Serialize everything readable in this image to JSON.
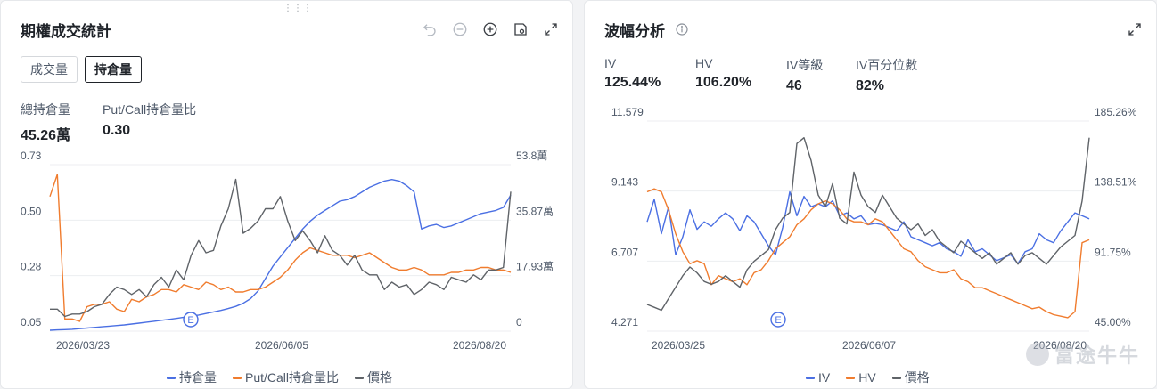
{
  "left": {
    "drag_glyph": "⋮⋮⋮",
    "title": "期權成交統計",
    "toolbar_icons": [
      "undo-icon",
      "zoom-out-icon",
      "zoom-in-icon",
      "settings-icon",
      "expand-icon"
    ],
    "tabs": [
      {
        "label": "成交量",
        "active": false
      },
      {
        "label": "持倉量",
        "active": true
      }
    ],
    "stats": [
      {
        "label": "總持倉量",
        "value": "45.26萬"
      },
      {
        "label": "Put/Call持倉量比",
        "value": "0.30"
      }
    ],
    "legend": [
      "持倉量",
      "Put/Call持倉量比",
      "價格"
    ],
    "colors": {
      "open_interest": "#4a6fe3",
      "ratio": "#f07c2e",
      "price": "#5f6368"
    },
    "earnings_marker": "E"
  },
  "right": {
    "title": "波幅分析",
    "toolbar_icons": [
      "expand-icon"
    ],
    "stats": [
      {
        "label": "IV",
        "value": "125.44%"
      },
      {
        "label": "HV",
        "value": "106.20%"
      },
      {
        "label": "IV等級",
        "value": "46"
      },
      {
        "label": "IV百分位數",
        "value": "82%"
      }
    ],
    "legend": [
      "IV",
      "HV",
      "價格"
    ],
    "colors": {
      "iv": "#4a6fe3",
      "hv": "#f07c2e",
      "price": "#5f6368"
    },
    "earnings_marker": "E",
    "watermark": "富途牛牛"
  },
  "chart_data": [
    {
      "type": "line",
      "x_labels": [
        "2026/03/23",
        "2026/06/05",
        "2026/08/20"
      ],
      "left_axis": {
        "ticks": [
          "0.73",
          "0.50",
          "0.28",
          "0.05"
        ],
        "range": [
          0.05,
          0.73
        ]
      },
      "right_axis": {
        "ticks": [
          "53.8萬",
          "35.87萬",
          "17.93萬",
          "0"
        ],
        "range": [
          0,
          53.8
        ]
      },
      "series": [
        {
          "name": "持倉量",
          "axis": "right",
          "values": [
            0.3,
            0.4,
            0.5,
            0.6,
            0.8,
            1.0,
            1.2,
            1.4,
            1.6,
            1.8,
            2.0,
            2.3,
            2.6,
            2.9,
            3.2,
            3.5,
            3.8,
            4.1,
            4.5,
            4.8,
            5.2,
            5.7,
            6.2,
            6.7,
            7.3,
            8.0,
            9.0,
            10.5,
            13.0,
            17.0,
            21.0,
            24.0,
            27.0,
            30.0,
            33.0,
            35.5,
            37.5,
            39.0,
            40.5,
            42.0,
            42.5,
            43.5,
            45.0,
            46.5,
            47.5,
            48.5,
            49.0,
            48.5,
            47.0,
            45.0,
            33.0,
            34.0,
            34.5,
            33.5,
            34.0,
            35.0,
            36.0,
            37.0,
            38.0,
            38.5,
            39.0,
            40.0,
            44.0
          ]
        },
        {
          "name": "Put/Call持倉量比",
          "axis": "left",
          "values": [
            0.6,
            0.69,
            0.1,
            0.1,
            0.09,
            0.15,
            0.16,
            0.16,
            0.17,
            0.14,
            0.13,
            0.18,
            0.17,
            0.19,
            0.2,
            0.22,
            0.22,
            0.21,
            0.24,
            0.23,
            0.22,
            0.25,
            0.24,
            0.22,
            0.23,
            0.21,
            0.21,
            0.22,
            0.22,
            0.23,
            0.25,
            0.27,
            0.3,
            0.34,
            0.37,
            0.39,
            0.38,
            0.37,
            0.36,
            0.36,
            0.36,
            0.35,
            0.36,
            0.37,
            0.35,
            0.33,
            0.31,
            0.3,
            0.3,
            0.31,
            0.3,
            0.28,
            0.28,
            0.28,
            0.29,
            0.29,
            0.3,
            0.3,
            0.31,
            0.31,
            0.3,
            0.3,
            0.29
          ]
        },
        {
          "name": "價格",
          "axis": "left",
          "values": [
            0.14,
            0.14,
            0.11,
            0.12,
            0.12,
            0.13,
            0.15,
            0.16,
            0.2,
            0.23,
            0.22,
            0.2,
            0.22,
            0.19,
            0.24,
            0.27,
            0.23,
            0.3,
            0.26,
            0.36,
            0.42,
            0.37,
            0.38,
            0.48,
            0.55,
            0.67,
            0.45,
            0.47,
            0.5,
            0.55,
            0.55,
            0.6,
            0.5,
            0.42,
            0.46,
            0.42,
            0.37,
            0.44,
            0.38,
            0.36,
            0.32,
            0.36,
            0.3,
            0.28,
            0.28,
            0.22,
            0.25,
            0.23,
            0.24,
            0.2,
            0.22,
            0.25,
            0.24,
            0.22,
            0.27,
            0.26,
            0.25,
            0.28,
            0.26,
            0.3,
            0.3,
            0.31,
            0.62
          ]
        }
      ]
    },
    {
      "type": "line",
      "x_labels": [
        "2026/03/25",
        "2026/06/07",
        "2026/08/20"
      ],
      "left_axis": {
        "ticks": [
          "11.579",
          "9.143",
          "6.707",
          "4.271"
        ],
        "range": [
          4.271,
          11.579
        ]
      },
      "right_axis": {
        "ticks": [
          "185.26%",
          "138.51%",
          "91.75%",
          "45.00%"
        ],
        "range": [
          45.0,
          185.26
        ]
      },
      "series": [
        {
          "name": "IV",
          "axis": "right",
          "values": [
            118,
            133,
            110,
            128,
            96,
            108,
            126,
            113,
            118,
            115,
            120,
            124,
            120,
            112,
            122,
            118,
            110,
            102,
            96,
            114,
            138,
            122,
            135,
            128,
            130,
            128,
            132,
            122,
            124,
            120,
            122,
            116,
            117,
            116,
            114,
            112,
            118,
            108,
            106,
            104,
            102,
            104,
            100,
            98,
            95,
            106,
            98,
            100,
            96,
            92,
            94,
            96,
            90,
            98,
            100,
            110,
            106,
            104,
            112,
            118,
            124,
            122,
            120
          ]
        },
        {
          "name": "HV",
          "axis": "right",
          "values": [
            138,
            140,
            138,
            126,
            110,
            98,
            90,
            92,
            90,
            76,
            82,
            80,
            78,
            80,
            76,
            84,
            86,
            92,
            100,
            104,
            108,
            116,
            120,
            126,
            130,
            132,
            130,
            126,
            120,
            118,
            118,
            116,
            120,
            118,
            112,
            106,
            100,
            98,
            92,
            88,
            86,
            84,
            84,
            86,
            80,
            78,
            74,
            74,
            72,
            70,
            68,
            66,
            64,
            62,
            60,
            61,
            58,
            56,
            55,
            54,
            58,
            104,
            106
          ]
        },
        {
          "name": "價格",
          "axis": "left",
          "values": [
            5.2,
            5.1,
            5.0,
            5.4,
            5.8,
            6.2,
            6.5,
            6.3,
            6.0,
            5.9,
            6.0,
            6.2,
            6.0,
            5.8,
            6.4,
            6.7,
            6.9,
            7.1,
            7.8,
            8.2,
            8.4,
            10.8,
            11.0,
            10.2,
            9.0,
            8.6,
            9.4,
            8.2,
            8.0,
            9.8,
            9.0,
            8.6,
            8.4,
            9.0,
            8.6,
            8.2,
            8.0,
            7.8,
            8.0,
            7.6,
            7.8,
            7.4,
            7.2,
            7.0,
            7.4,
            7.2,
            7.0,
            6.8,
            7.0,
            6.6,
            6.8,
            7.0,
            6.6,
            6.9,
            7.0,
            6.8,
            6.6,
            6.9,
            7.2,
            7.4,
            7.6,
            8.8,
            11.0
          ]
        }
      ]
    }
  ]
}
